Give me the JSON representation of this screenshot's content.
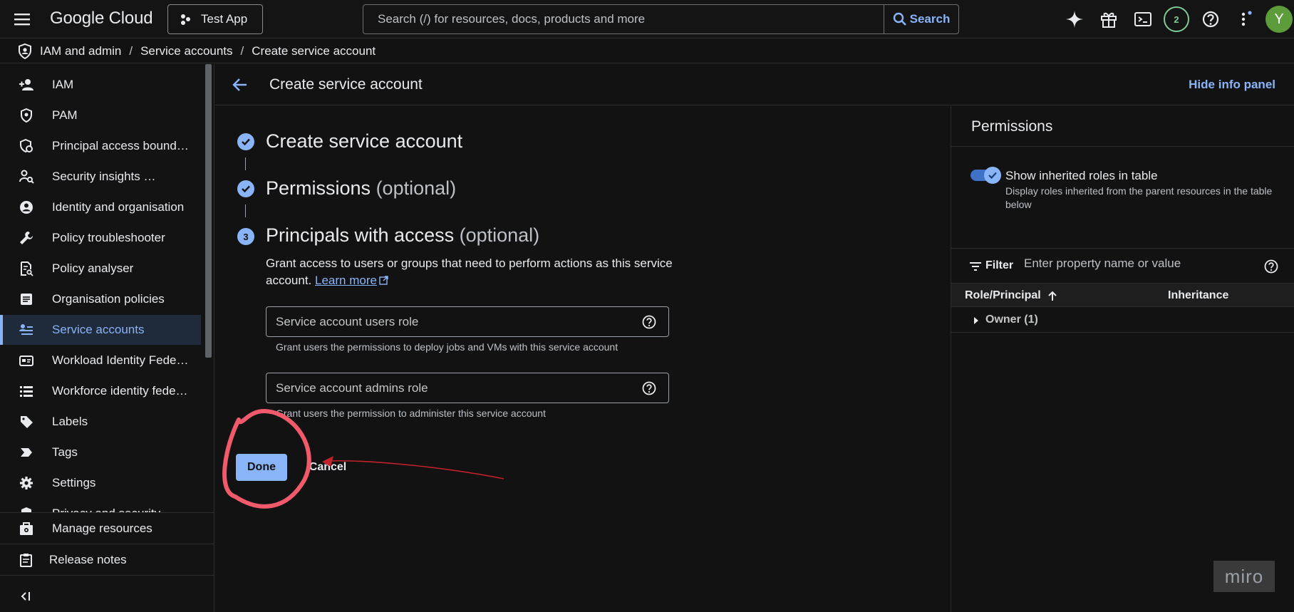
{
  "topbar": {
    "logo": "Google Cloud",
    "project": "Test App",
    "search_placeholder": "Search (/) for resources, docs, products and more",
    "search_button": "Search",
    "notification_count": "2",
    "avatar_letter": "Y",
    "icons": [
      "menu-icon",
      "gemini-sparkle-icon",
      "gift-icon",
      "terminal-icon",
      "help-icon",
      "more-vert-icon"
    ]
  },
  "breadcrumb": [
    "IAM and admin",
    "Service accounts",
    "Create service account"
  ],
  "sidebar": {
    "items": [
      {
        "label": "IAM",
        "icon": "person-add-icon"
      },
      {
        "label": "PAM",
        "icon": "shield-icon"
      },
      {
        "label": "Principal access bound…",
        "icon": "policy-shield-icon"
      },
      {
        "label": "Security insights …",
        "icon": "person-search-icon"
      },
      {
        "label": "Identity and organisation",
        "icon": "account-circle-icon"
      },
      {
        "label": "Policy troubleshooter",
        "icon": "wrench-icon"
      },
      {
        "label": "Policy analyser",
        "icon": "document-search-icon"
      },
      {
        "label": "Organisation policies",
        "icon": "list-document-icon"
      },
      {
        "label": "Service accounts",
        "icon": "service-account-icon",
        "active": true
      },
      {
        "label": "Workload Identity Fede…",
        "icon": "id-card-icon"
      },
      {
        "label": "Workforce identity fede…",
        "icon": "list-icon"
      },
      {
        "label": "Labels",
        "icon": "label-icon"
      },
      {
        "label": "Tags",
        "icon": "tag-chevron-icon"
      },
      {
        "label": "Settings",
        "icon": "gear-icon"
      },
      {
        "label": "Privacy and security",
        "icon": "privacy-icon"
      }
    ],
    "bottom": [
      {
        "label": "Manage resources",
        "icon": "manage-resources-icon"
      },
      {
        "label": "Release notes",
        "icon": "release-notes-icon"
      }
    ]
  },
  "header": {
    "title": "Create service account",
    "hide_info": "Hide info panel"
  },
  "steps": {
    "step1": {
      "title": "Create service account"
    },
    "step2": {
      "title": "Permissions",
      "optional": "(optional)"
    },
    "step3": {
      "number": "3",
      "title": "Principals with access",
      "optional": "(optional)"
    },
    "description": "Grant access to users or groups that need to perform actions as this service account.",
    "learn_more": "Learn more",
    "users_role": {
      "placeholder": "Service account users role",
      "hint": "Grant users the permissions to deploy jobs and VMs with this service account"
    },
    "admins_role": {
      "placeholder": "Service account admins role",
      "hint": "Grant users the permission to administer this service account"
    },
    "done": "Done",
    "cancel": "Cancel"
  },
  "info_panel": {
    "title": "Permissions",
    "toggle_label": "Show inherited roles in table",
    "toggle_on": true,
    "toggle_sub": "Display roles inherited from the parent resources in the table below",
    "filter_label": "Filter",
    "filter_placeholder": "Enter property name or value",
    "columns": [
      "Role/Principal",
      "Inheritance"
    ],
    "rows": [
      {
        "label": "Owner (1)"
      }
    ]
  },
  "watermark": "miro",
  "colors": {
    "accent": "#8ab4f8",
    "annotation_red": "#f05a6b",
    "arrow_red": "#c2222b",
    "background": "#121212"
  }
}
